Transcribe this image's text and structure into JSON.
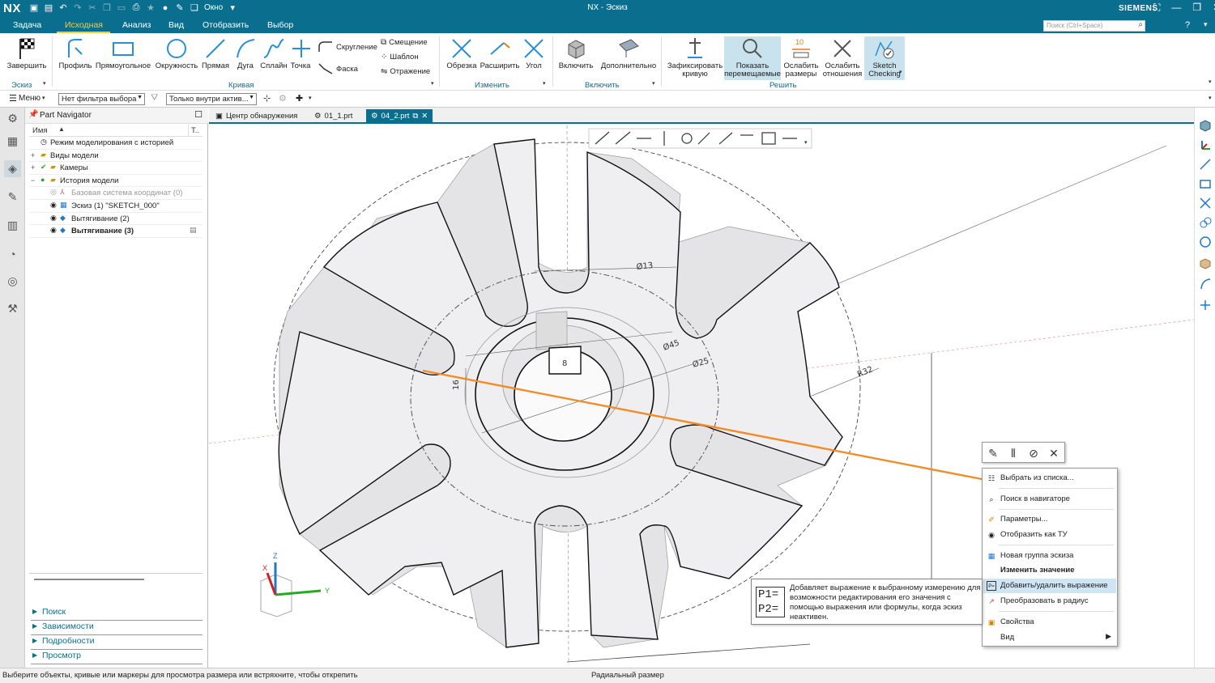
{
  "titlebar": {
    "logo": "NX",
    "window_menu": "Окно",
    "title": "NX - Эскиз",
    "brand": "SIEMENS"
  },
  "menu": {
    "tabs": [
      "Задача",
      "Исходная",
      "Анализ",
      "Вид",
      "Отобразить",
      "Выбор"
    ],
    "active_tab": "Исходная",
    "search_placeholder": "Поиск (Ctrl+Space)"
  },
  "ribbon": {
    "finish": "Завершить",
    "profile": "Профиль",
    "rectangle": "Прямоугольное",
    "circle": "Окружность",
    "line": "Прямая",
    "arc": "Дуга",
    "spline": "Сплайн",
    "point": "Точка",
    "fillet": "Скругление",
    "chamfer": "Фаска",
    "offset": "Смещение",
    "pattern": "Шаблон",
    "mirror": "Отражение",
    "trim": "Обрезка",
    "extend": "Расширить",
    "corner": "Угол",
    "include": "Включить",
    "additional": "Дополнительно",
    "fix_curve_1": "Зафиксировать",
    "fix_curve_2": "кривую",
    "show_move_1": "Показать",
    "show_move_2": "перемещаемые",
    "relax_dim_1": "Ослабить",
    "relax_dim_2": "размеры",
    "relax_rel_1": "Ослабить",
    "relax_rel_2": "отношения",
    "sketch_check_1": "Sketch",
    "sketch_check_2": "Checking",
    "groups": {
      "sketch": "Эскиз",
      "curve": "Кривая",
      "edit": "Изменить",
      "include": "Включить",
      "solve": "Решить"
    }
  },
  "selbar": {
    "menu": "Меню",
    "filter": "Нет фильтра выбора",
    "scope": "Только внутри актив..."
  },
  "navigator": {
    "title": "Part Navigator",
    "col_name": "Имя",
    "col_t": "Т..",
    "items": [
      {
        "label": "Режим моделирования с историей",
        "icon": "clock-icon"
      },
      {
        "label": "Виды модели",
        "icon": "folder-icon"
      },
      {
        "label": "Камеры",
        "icon": "camera-folder-icon"
      },
      {
        "label": "История модели",
        "icon": "history-folder-icon"
      },
      {
        "label": "Базовая система координат (0)",
        "icon": "datum-csys-icon"
      },
      {
        "label": "Эскиз (1) \"SKETCH_000\"",
        "icon": "sketch-icon"
      },
      {
        "label": "Вытягивание (2)",
        "icon": "extrude-icon"
      },
      {
        "label": "Вытягивание (3)",
        "icon": "extrude-icon"
      }
    ],
    "sections": [
      "Поиск",
      "Зависимости",
      "Подробности",
      "Просмотр"
    ]
  },
  "filetabs": [
    "Центр обнаружения",
    "01_1.prt",
    "04_2.prt"
  ],
  "active_file": "04_2.prt",
  "dimensions": {
    "d13": "Ø13",
    "d45": "Ø45",
    "d25": "Ø25",
    "r32": "R32",
    "w8": "8",
    "h16": "16"
  },
  "axes": {
    "z": "Z",
    "y": "Y",
    "x": "X"
  },
  "context_menu": [
    {
      "label": "Выбрать из списка...",
      "icon": "list-select-icon"
    },
    {
      "label": "Поиск в навигаторе",
      "icon": "navigator-find-icon"
    },
    {
      "label": "Параметры...",
      "icon": "parameters-icon"
    },
    {
      "label": "Отобразить как ТУ",
      "icon": "display-pmi-icon"
    },
    {
      "label": "Новая группа эскиза",
      "icon": "sketch-group-icon"
    },
    {
      "label": "Изменить значение",
      "icon": "edit-value-icon"
    },
    {
      "label": "Добавить/удалить выражение",
      "icon": "expression-icon"
    },
    {
      "label": "Преобразовать в радиус",
      "icon": "convert-radius-icon"
    },
    {
      "label": "Свойства",
      "icon": "properties-icon"
    },
    {
      "label": "Вид",
      "icon": "view-icon"
    }
  ],
  "context_highlight": "Добавить/удалить выражение",
  "tooltip": {
    "icon_l1": "P1=",
    "icon_l2": "P2=",
    "text": "Добавляет выражение к выбранному измерению для возможности редактирования его значения с помощью выражения или формулы, когда эскиз неактивен."
  },
  "status": {
    "prompt": "Выберите объекты, кривые или маркеры для просмотра размера или встряхните, чтобы открепить",
    "selection": "Радиальный размер"
  },
  "colors": {
    "titlebar": "#0a6e8e",
    "active_tab": "#ffcc33",
    "highlight_line": "#f28c28",
    "menu_highlight": "#cfe5f3"
  }
}
